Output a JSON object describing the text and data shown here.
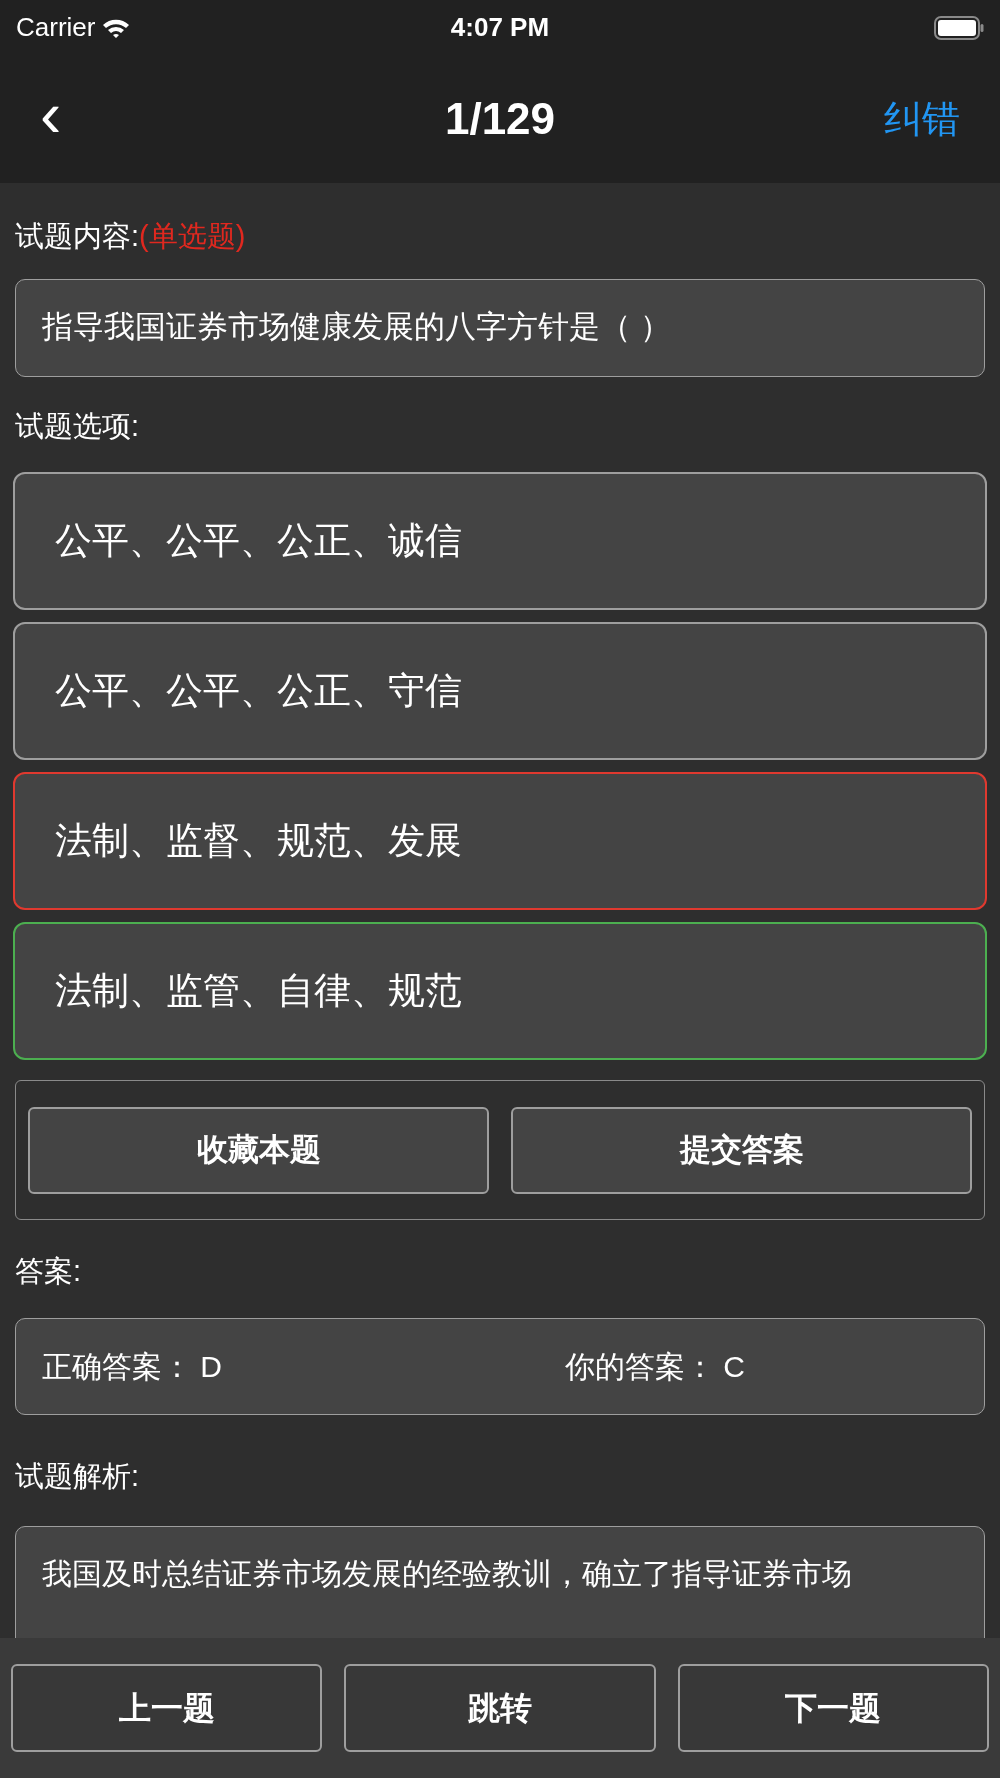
{
  "status_bar": {
    "carrier": "Carrier",
    "time": "4:07 PM"
  },
  "nav": {
    "back": "‹",
    "title": "1/129",
    "action": "纠错"
  },
  "question": {
    "label": "试题内容:",
    "type": "(单选题)",
    "text": "指导我国证券市场健康发展的八字方针是（ ）"
  },
  "options_label": "试题选项:",
  "options": [
    {
      "text": "公平、公平、公正、诚信",
      "color": "#9e9e9e"
    },
    {
      "text": "公平、公平、公正、守信",
      "color": "#9e9e9e"
    },
    {
      "text": "法制、监督、规范、发展",
      "color": "#e0392f"
    },
    {
      "text": "法制、监管、自律、规范",
      "color": "#4caf50"
    }
  ],
  "actions": [
    "收藏本题",
    "提交答案"
  ],
  "answer": {
    "label": "答案:",
    "correct_label": "正确答案：",
    "correct": "D",
    "yours_label": "你的答案：",
    "yours": "C"
  },
  "analysis": {
    "label": "试题解析:",
    "text": "我国及时总结证券市场发展的经验教训，确立了指导证券市场"
  },
  "bottom_buttons": [
    "上一题",
    "跳转",
    "下一题"
  ]
}
